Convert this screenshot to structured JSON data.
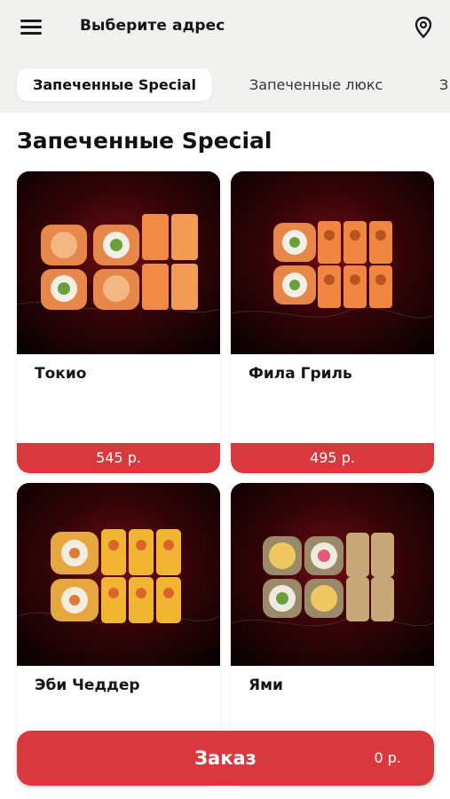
{
  "header": {
    "address_label": "Выберите адрес",
    "menu_icon": "hamburger-menu-icon",
    "location_icon": "location-pin-icon"
  },
  "tabs": [
    {
      "label": "Запеченные Special",
      "active": true
    },
    {
      "label": "Запеченные люкс",
      "active": false
    },
    {
      "label": "З",
      "active": false
    }
  ],
  "section": {
    "title": "Запеченные Special"
  },
  "products": [
    {
      "name": "Токио",
      "price": "545 р."
    },
    {
      "name": "Фила Гриль",
      "price": "495 р."
    },
    {
      "name": "Эби Чеддер",
      "price": ""
    },
    {
      "name": "Ями",
      "price": ""
    }
  ],
  "order": {
    "label": "Заказ",
    "sum": "0 р."
  },
  "colors": {
    "accent": "#d8393f",
    "background": "#f1f1f0",
    "photo_bg": "#3a0508"
  }
}
